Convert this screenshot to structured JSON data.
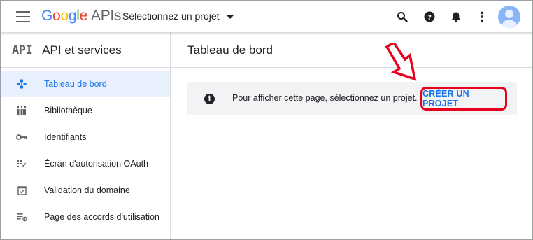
{
  "topbar": {
    "logo_google": "Google",
    "logo_apis": "APIs",
    "project_picker_label": "Sélectionnez un projet",
    "icons": [
      "menu-icon",
      "search-icon",
      "help-icon",
      "notifications-icon",
      "more-vert-icon",
      "account-avatar"
    ]
  },
  "sidebar": {
    "badge": "API",
    "title": "API et services",
    "items": [
      {
        "label": "Tableau de bord",
        "icon": "dashboard-icon",
        "active": true
      },
      {
        "label": "Bibliothèque",
        "icon": "library-icon",
        "active": false
      },
      {
        "label": "Identifiants",
        "icon": "key-icon",
        "active": false
      },
      {
        "label": "Écran d'autorisation OAuth",
        "icon": "oauth-consent-icon",
        "active": false
      },
      {
        "label": "Validation du domaine",
        "icon": "domain-verification-icon",
        "active": false
      },
      {
        "label": "Page des accords d'utilisation",
        "icon": "agreements-icon",
        "active": false
      }
    ]
  },
  "main": {
    "page_title": "Tableau de bord",
    "banner": {
      "message": "Pour afficher cette page, sélectionnez un projet.",
      "action_label": "CRÉER UN PROJET"
    }
  },
  "colors": {
    "accent": "#1a73e8",
    "active_bg": "#e8f0fe",
    "annotation_red": "#e8001c"
  }
}
